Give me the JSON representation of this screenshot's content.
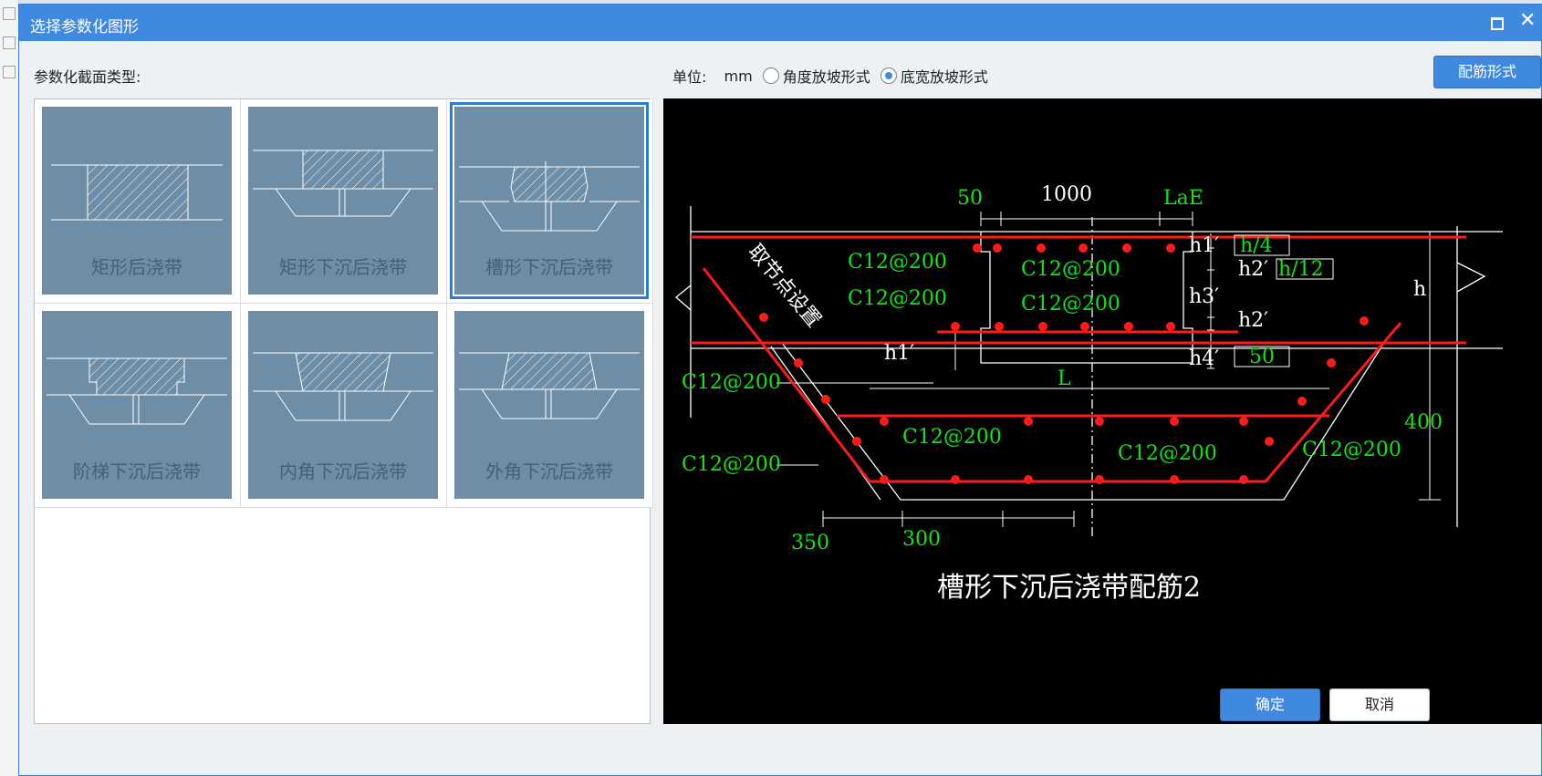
{
  "dialog": {
    "title": "选择参数化图形",
    "section_label": "参数化截面类型:",
    "unit_label": "单位:",
    "unit_value": "mm",
    "radio_angle": "角度放坡形式",
    "radio_width": "底宽放坡形式",
    "radio_selected": "底宽放坡形式",
    "rebar_button": "配筋形式",
    "ok_button": "确定",
    "cancel_button": "取消"
  },
  "shapes": [
    {
      "label": "矩形后浇带"
    },
    {
      "label": "矩形下沉后浇带"
    },
    {
      "label": "槽形下沉后浇带",
      "selected": true
    },
    {
      "label": "阶梯下沉后浇带"
    },
    {
      "label": "内角下沉后浇带"
    },
    {
      "label": "外角下沉后浇带"
    }
  ],
  "preview": {
    "caption": "槽形下沉后浇带配筋2",
    "dims_top": [
      "50",
      "1000",
      "LaE"
    ],
    "dims_right": [
      "h1′",
      "h/4",
      "h2′",
      "h/12",
      "h3′",
      "h2′",
      "h4′",
      "50",
      "h"
    ],
    "h1_label": "h1′",
    "rebar_labels": [
      "C12@200",
      "C12@200",
      "C12@200",
      "C12@200",
      "C12@200",
      "C12@200",
      "C12@200",
      "C12@200",
      "C12@200"
    ],
    "slope_note": "取节点设置",
    "L_label": "L",
    "depth_label": "400",
    "dims_bottom": [
      "350",
      "300"
    ]
  },
  "colors": {
    "title_bar": "#3f8ae0",
    "thumb_bg": "#6d8ea6",
    "rebar_red": "#ff1a1a",
    "label_green": "#12e612"
  }
}
